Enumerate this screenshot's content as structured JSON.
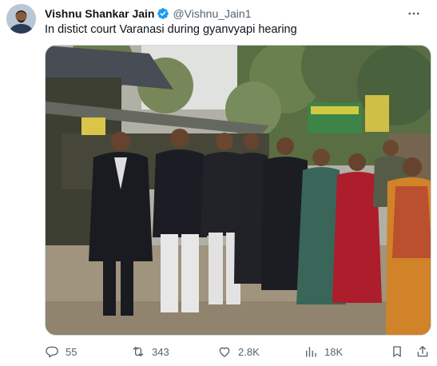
{
  "tweet": {
    "author_name": "Vishnu Shankar Jain",
    "handle": "@Vishnu_Jain1",
    "verified": true,
    "text": "In distict court Varanasi during gyanvyapi hearing",
    "media_description_icon": "photo"
  },
  "actions": {
    "replies": "55",
    "reposts": "343",
    "likes": "2.8K",
    "views": "18K"
  },
  "colors": {
    "text_primary": "#0f1419",
    "text_secondary": "#536471",
    "verified_blue": "#1d9bf0",
    "border": "#cfd9de"
  },
  "icons": [
    "reply-icon",
    "repost-icon",
    "like-icon",
    "views-icon",
    "bookmark-icon",
    "share-icon",
    "more-icon",
    "verified-icon"
  ],
  "signage": {
    "sign_left": "",
    "sign_right": ""
  }
}
